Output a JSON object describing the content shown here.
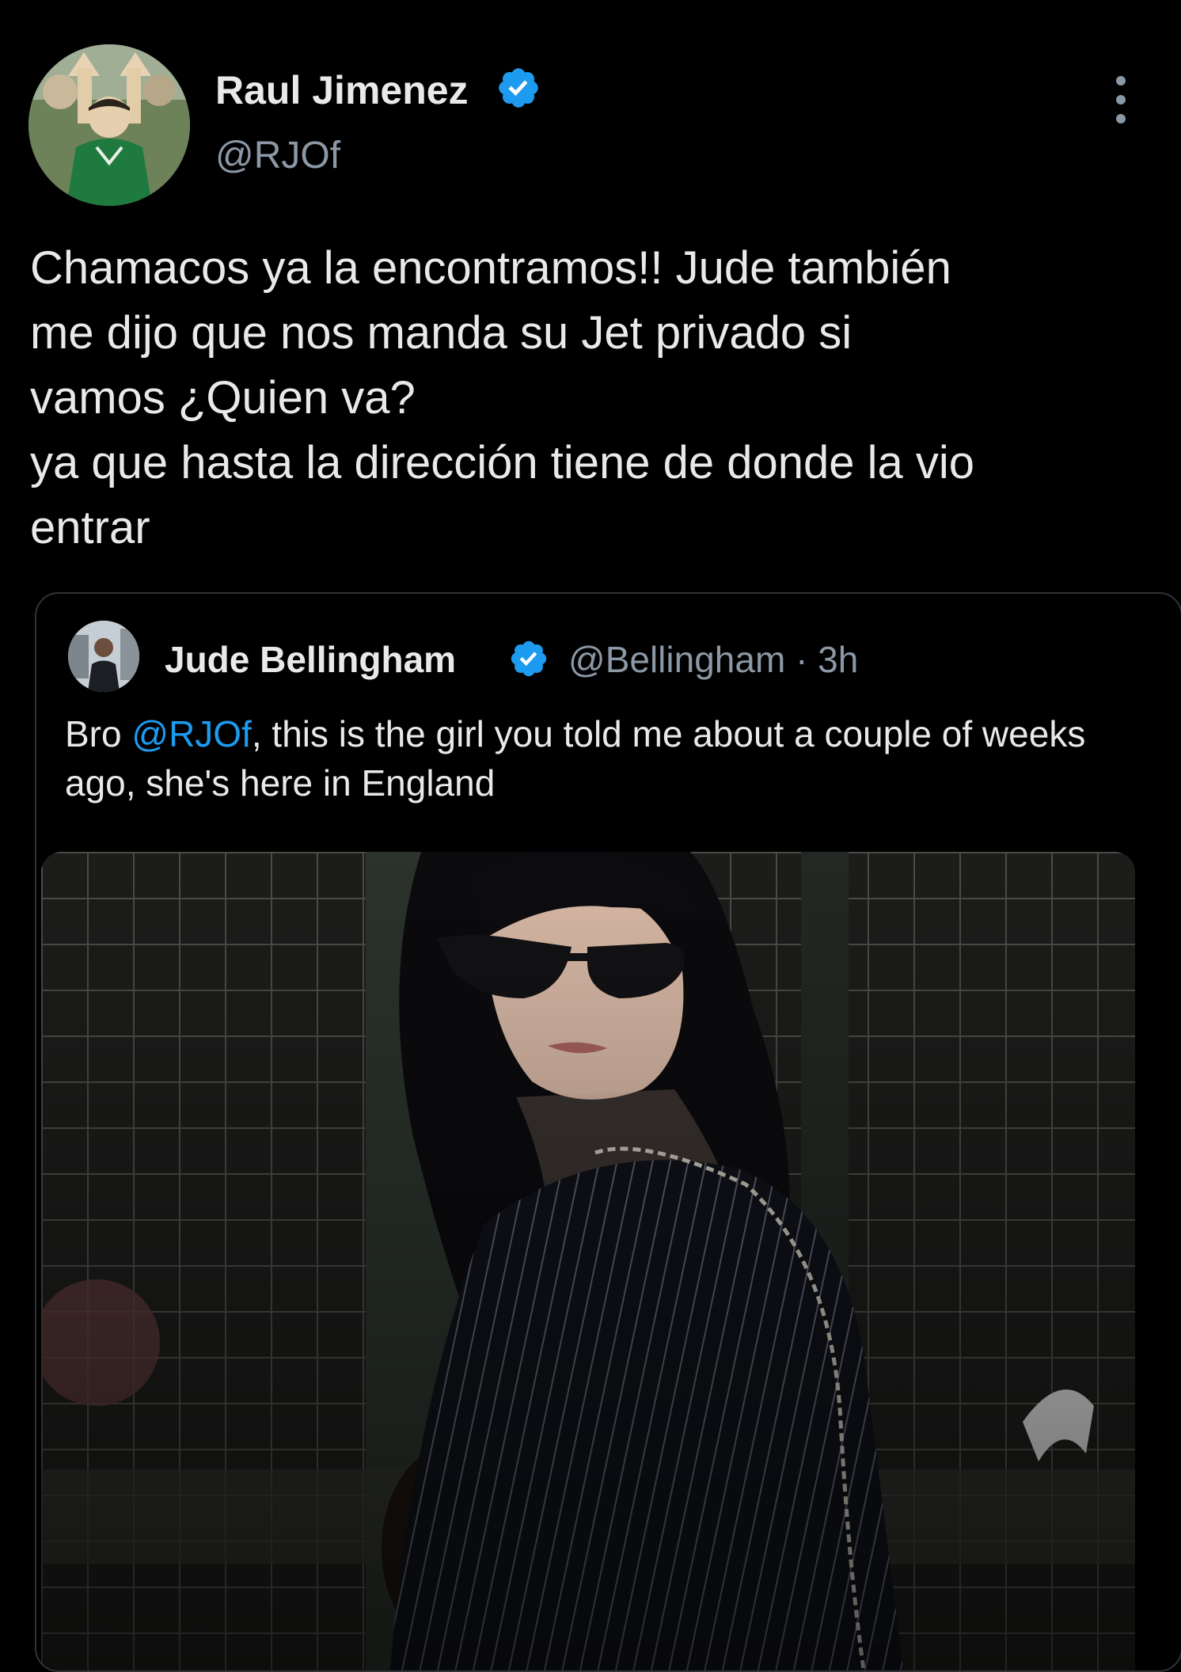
{
  "tweet": {
    "author": {
      "display_name": "Raul Jimenez",
      "handle": "@RJOf",
      "verified": true
    },
    "text": "Chamacos ya la encontramos!! Jude también\nme dijo que nos manda su Jet privado si\nvamos ¿Quien va?\nya que hasta la dirección tiene de donde la vio\nentrar",
    "more_icon": "more-vertical-icon"
  },
  "quoted_tweet": {
    "author": {
      "display_name": "Jude Bellingham",
      "handle": "@Bellingham",
      "verified": true
    },
    "separator": "·",
    "time": "3h",
    "text_before": "Bro ",
    "mention": "@RJOf",
    "text_after": ", this is the girl you told me about a couple of weeks ago, she's here in England"
  },
  "colors": {
    "background": "#000000",
    "text_primary": "#e7e9ea",
    "text_secondary": "#8b98a5",
    "accent": "#1d9bf0",
    "border": "#2f3336"
  }
}
